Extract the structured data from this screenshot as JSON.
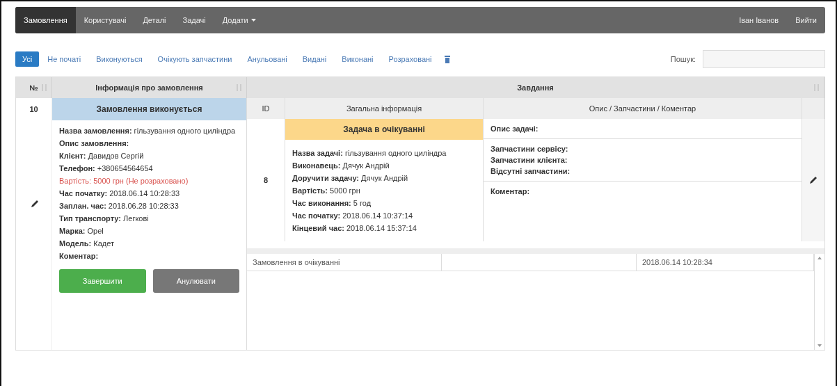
{
  "navbar": {
    "items": [
      {
        "label": "Замовлення",
        "selected": true,
        "dropdown": false
      },
      {
        "label": "Користувачі",
        "selected": false,
        "dropdown": false
      },
      {
        "label": "Деталі",
        "selected": false,
        "dropdown": false
      },
      {
        "label": "Задачі",
        "selected": false,
        "dropdown": false
      },
      {
        "label": "Додати",
        "selected": false,
        "dropdown": true
      }
    ],
    "user": "Іван Іванов",
    "logout": "Вийти"
  },
  "filters": {
    "items": [
      {
        "label": "Усі",
        "selected": true
      },
      {
        "label": "Не початі",
        "selected": false
      },
      {
        "label": "Виконуються",
        "selected": false
      },
      {
        "label": "Очікують запчастини",
        "selected": false
      },
      {
        "label": "Анульовані",
        "selected": false
      },
      {
        "label": "Видані",
        "selected": false
      },
      {
        "label": "Виконані",
        "selected": false
      },
      {
        "label": "Розраховані",
        "selected": false
      }
    ],
    "search_label": "Пошук:"
  },
  "table": {
    "columns": [
      "№",
      "Інформація про замовлення",
      "Завдання"
    ],
    "order": {
      "number": "10",
      "status": "Замовлення виконується",
      "lines": [
        {
          "text": "**Назва замовлення:** гільзування одного циліндра",
          "alert": false
        },
        {
          "text": "**Опис замовлення:**",
          "alert": false
        },
        {
          "text": "**Клієнт:** Давидов Сергій",
          "alert": false
        },
        {
          "text": "**Телефон:** +380654564654",
          "alert": false
        },
        {
          "text": "Вартість: 5000 грн (Не розраховано)",
          "alert": true
        },
        {
          "text": "**Час початку:** 2018.06.14 10:28:33",
          "alert": false
        },
        {
          "text": "**Заплан. час:** 2018.06.28 10:28:33",
          "alert": false
        },
        {
          "text": "**Тип транспорту:** Легкові",
          "alert": false
        },
        {
          "text": "**Марка:** Opel",
          "alert": false
        },
        {
          "text": "**Модель:** Кадет",
          "alert": false
        },
        {
          "text": "**Коментар:**",
          "alert": false
        }
      ],
      "buttons": [
        {
          "label": "Завершити",
          "kind": "success"
        },
        {
          "label": "Анулювати",
          "kind": "secondary"
        }
      ]
    },
    "tasks": {
      "columns": [
        "ID",
        "Загальна інформація",
        "Опис / Запчастини / Коментар"
      ],
      "rows": [
        {
          "id": "8",
          "status": "Задача в очікуванні",
          "lines": [
            "**Назва задачі:** гільзування одного циліндра",
            "**Виконавець:** Дячук Андрій",
            "**Доручити задачу:** Дячук Андрій",
            "**Вартість:** 5000 грн",
            "**Час виконання:** 5 год",
            "**Час початку:** 2018.06.14 10:37:14",
            "**Кінцевий час:** 2018.06.14 15:37:14"
          ],
          "description": "Опис задачі:",
          "parts": [
            "Запчастини сервісу:",
            "Запчастини клієнта:",
            "Відсутні запчастини:"
          ],
          "comment": "Коментар:"
        }
      ]
    },
    "history": [
      {
        "event": "Замовлення в очікуванні",
        "time": "2018.06.14 10:28:34"
      }
    ]
  }
}
